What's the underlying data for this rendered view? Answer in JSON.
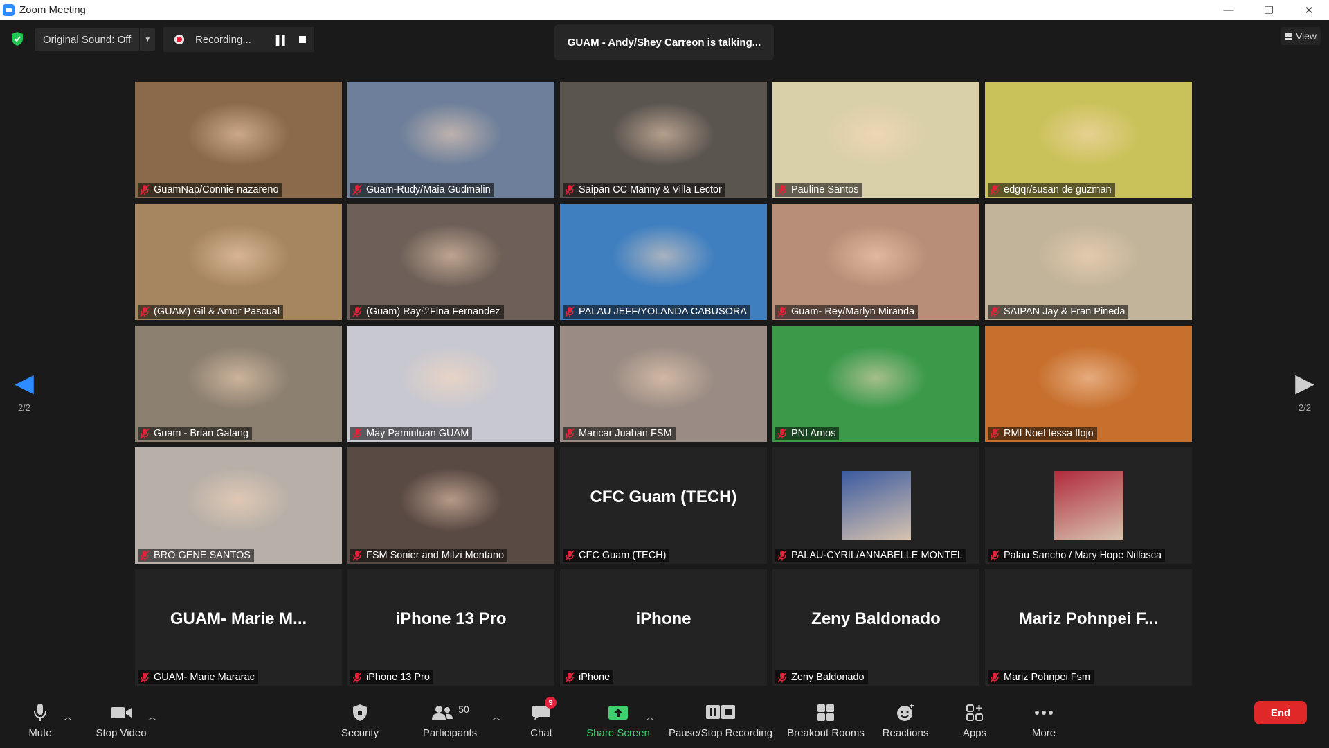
{
  "window": {
    "title": "Zoom Meeting",
    "minimize": "—",
    "restore": "❐",
    "close": "✕"
  },
  "topbar": {
    "original_sound": "Original Sound: Off",
    "recording": "Recording...",
    "talking": "GUAM - Andy/Shey Carreon is talking...",
    "view": "View"
  },
  "pagination": {
    "left": "2/2",
    "right": "2/2"
  },
  "tiles": [
    {
      "name": "GuamNap/Connie nazareno",
      "bg": "#8a6a4a"
    },
    {
      "name": "Guam-Rudy/Maia Gudmalin",
      "bg": "#6d7f9a"
    },
    {
      "name": "Saipan CC Manny & Villa Lector",
      "bg": "#5b5550"
    },
    {
      "name": "Pauline Santos",
      "bg": "#d9cfa8"
    },
    {
      "name": "edgqr/susan de guzman",
      "bg": "#c9c25a"
    },
    {
      "name": "(GUAM) Gil & Amor Pascual",
      "bg": "#a68660"
    },
    {
      "name": "(Guam) Ray♡Fina Fernandez",
      "bg": "#6e6058"
    },
    {
      "name": "PALAU JEFF/YOLANDA CABUSORA",
      "bg": "#3f7fc0"
    },
    {
      "name": "Guam- Rey/Marlyn Miranda",
      "bg": "#b98e78"
    },
    {
      "name": "SAIPAN Jay & Fran Pineda",
      "bg": "#c2b49a"
    },
    {
      "name": "Guam - Brian Galang",
      "bg": "#8c8070"
    },
    {
      "name": "May Pamintuan GUAM",
      "bg": "#c8c8d0"
    },
    {
      "name": "Maricar Juaban FSM",
      "bg": "#9a8c84"
    },
    {
      "name": "PNI Amos",
      "bg": "#3a9a4a"
    },
    {
      "name": "RMI Noel tessa flojo",
      "bg": "#c7702e"
    },
    {
      "name": "BRO GENE SANTOS",
      "bg": "#b8b0a8"
    },
    {
      "name": "FSM Sonier and Mitzi Montano",
      "bg": "#5a4a44"
    },
    {
      "name": "CFC Guam (TECH)",
      "display": "CFC Guam (TECH)"
    },
    {
      "name": "PALAU-CYRIL/ANNABELLE MONTEL",
      "thumb": "#3a5aa0"
    },
    {
      "name": "Palau Sancho / Mary Hope Nillasca",
      "thumb": "#b02a3a"
    },
    {
      "name": "GUAM- Marie Mararac",
      "display": "GUAM- Marie M..."
    },
    {
      "name": "iPhone 13 Pro",
      "display": "iPhone 13 Pro"
    },
    {
      "name": "iPhone",
      "display": "iPhone"
    },
    {
      "name": "Zeny Baldonado",
      "display": "Zeny Baldonado"
    },
    {
      "name": "Mariz Pohnpei Fsm",
      "display": "Mariz Pohnpei F..."
    }
  ],
  "toolbar": {
    "mute": "Mute",
    "stop_video": "Stop Video",
    "security": "Security",
    "participants": "Participants",
    "participants_count": "50",
    "chat": "Chat",
    "chat_badge": "9",
    "share_screen": "Share Screen",
    "pause_stop_recording": "Pause/Stop Recording",
    "breakout_rooms": "Breakout Rooms",
    "reactions": "Reactions",
    "apps": "Apps",
    "more": "More",
    "end": "End"
  },
  "colors": {
    "accent": "#2d8cff",
    "share_green": "#3fd16e",
    "end_red": "#e02828",
    "mic_muted": "#e0233a"
  }
}
